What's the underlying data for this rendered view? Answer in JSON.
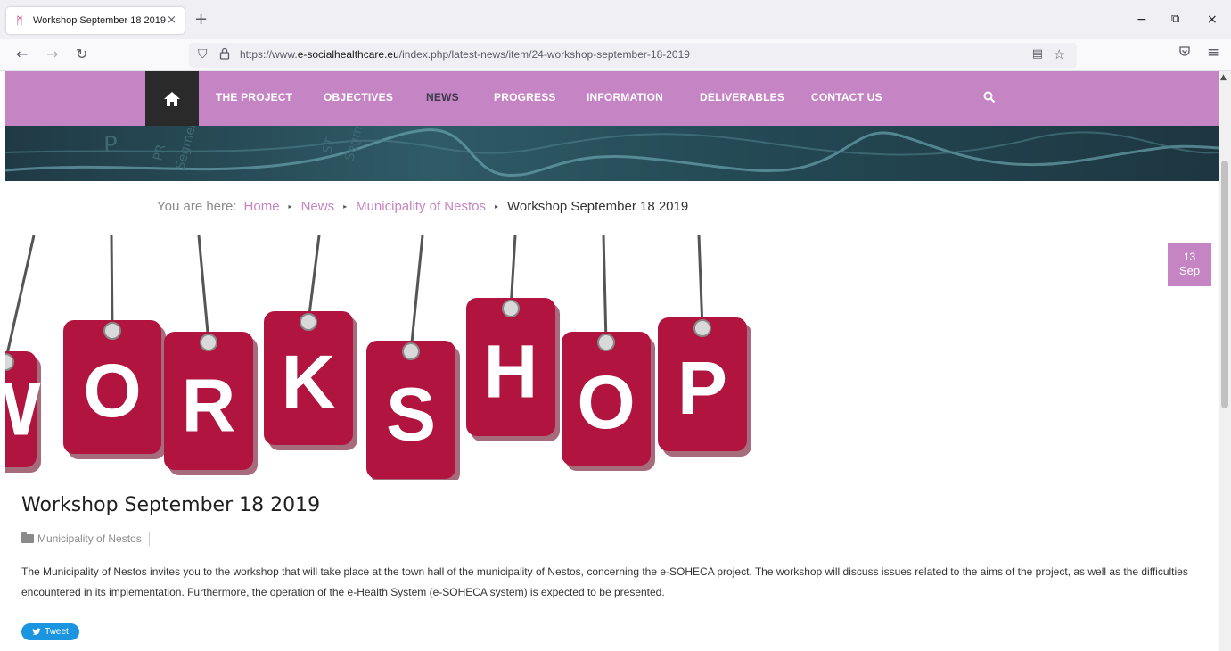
{
  "browser": {
    "tab": {
      "title": "Workshop September 18 2019",
      "favicon": "ᛗ",
      "close": "×"
    },
    "new_tab": "+",
    "window_controls": {
      "minimize": "−",
      "restore": "⧉",
      "close": "×"
    },
    "nav": {
      "back": "←",
      "forward": "→",
      "reload": "↻"
    },
    "url": {
      "prefix": "https://www.",
      "host": "e-socialhealthcare.eu",
      "path": "/index.php/latest-news/item/24-workshop-september-18-2019"
    },
    "icons": {
      "shield": "⛉",
      "lock": "🔒",
      "reader": "▤",
      "star": "☆",
      "pocket": "⬡",
      "menu": "≡"
    }
  },
  "site": {
    "menu": {
      "home_icon": "⌂",
      "items": [
        "THE PROJECT",
        "OBJECTIVES",
        "NEWS",
        "PROGRESS",
        "INFORMATION",
        "DELIVERABLES",
        "CONTACT US"
      ],
      "active": "NEWS",
      "search_icon": "⚲"
    },
    "breadcrumb": {
      "prefix": "You are here:",
      "items": [
        "Home",
        "News",
        "Municipality of Nestos"
      ],
      "current": "Workshop September 18 2019",
      "separator": "▸"
    },
    "hero": {
      "letters": [
        "W",
        "O",
        "R",
        "K",
        "S",
        "H",
        "O",
        "P"
      ]
    },
    "date": {
      "day": "13",
      "month": "Sep"
    },
    "article": {
      "title": "Workshop September 18 2019",
      "category": "Municipality of Nestos",
      "body": "The Municipality of Nestos invites you to the workshop that will take place at the town hall of the municipality of Nestos, concerning the e-SOHECA project. The workshop will discuss issues related to the aims of the project, as well as the difficulties encountered in its implementation. Furthermore, the operation of the e-Health System (e-SOHECA system) is expected to be presented."
    },
    "tweet": {
      "label": "Tweet",
      "icon": "🐦"
    },
    "colors": {
      "accent": "#c584c4",
      "tag": "#b0143f",
      "home_bg": "#2a2a2a",
      "tweet": "#1b95e0"
    }
  }
}
